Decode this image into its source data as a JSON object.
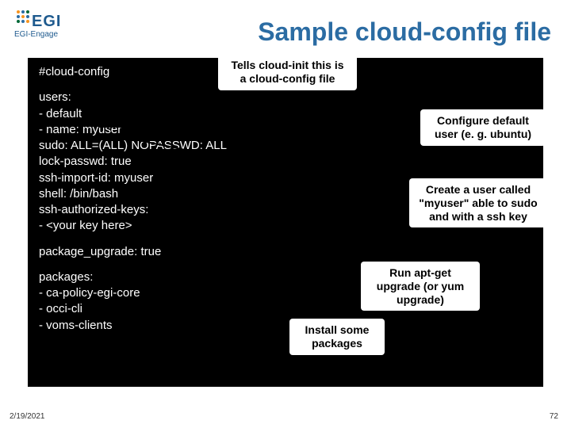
{
  "logo": {
    "brand": "EGI",
    "sub": "EGI-Engage"
  },
  "title": "Sample cloud-config file",
  "code": {
    "l1": "#cloud-config",
    "l2": "users:",
    "l3": "  - default",
    "l4": "  - name: myuser",
    "l5": "    sudo: ALL=(ALL) NOPASSWD: ALL",
    "l6": "    lock-passwd: true",
    "l7": "    ssh-import-id: myuser",
    "l8": "    shell: /bin/bash",
    "l9": "    ssh-authorized-keys:",
    "l10": "      - <your key here>",
    "l11": "package_upgrade: true",
    "l12": "packages:",
    "l13": "  - ca-policy-egi-core",
    "l14": "  - occi-cli",
    "l15": "  - voms-clients"
  },
  "callouts": {
    "c1a": "Tells cloud-init  this is",
    "c1b": "a cloud-config file",
    "c2a": "Configure default",
    "c2b": "user (e. g. ubuntu)",
    "c3a": "Create a user called",
    "c3b": "\"myuser\" able to sudo",
    "c3c": "and with a ssh key",
    "c4a": "Run apt-get",
    "c4b": "upgrade (or yum",
    "c4c": "upgrade)",
    "c5a": "Install some",
    "c5b": "packages"
  },
  "footer": {
    "date": "2/19/2021",
    "page": "72"
  }
}
